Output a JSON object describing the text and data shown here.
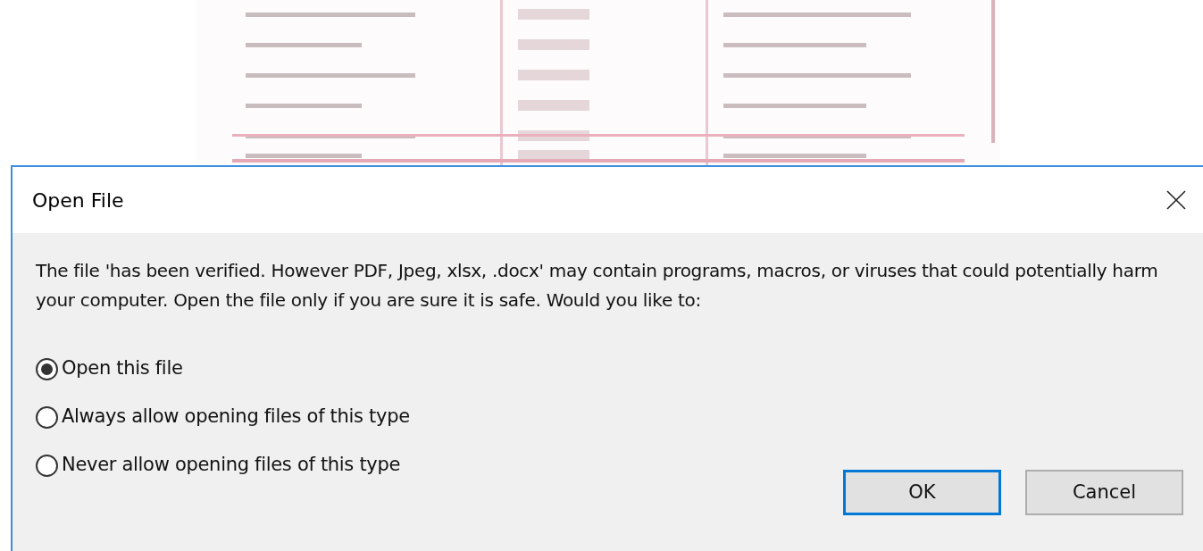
{
  "dialog": {
    "title": "Open File",
    "message": "The file 'has been verified. However PDF, Jpeg, xlsx, .docx' may contain programs, macros, or viruses that could potentially harm your computer. Open the file only if you are sure it is safe. Would you like to:",
    "options": [
      {
        "label": "Open this file",
        "selected": true
      },
      {
        "label": "Always allow opening files of this type",
        "selected": false
      },
      {
        "label": "Never allow opening files of this type",
        "selected": false
      }
    ],
    "buttons": [
      {
        "label": "OK",
        "default": true
      },
      {
        "label": "Cancel",
        "default": false
      }
    ]
  }
}
